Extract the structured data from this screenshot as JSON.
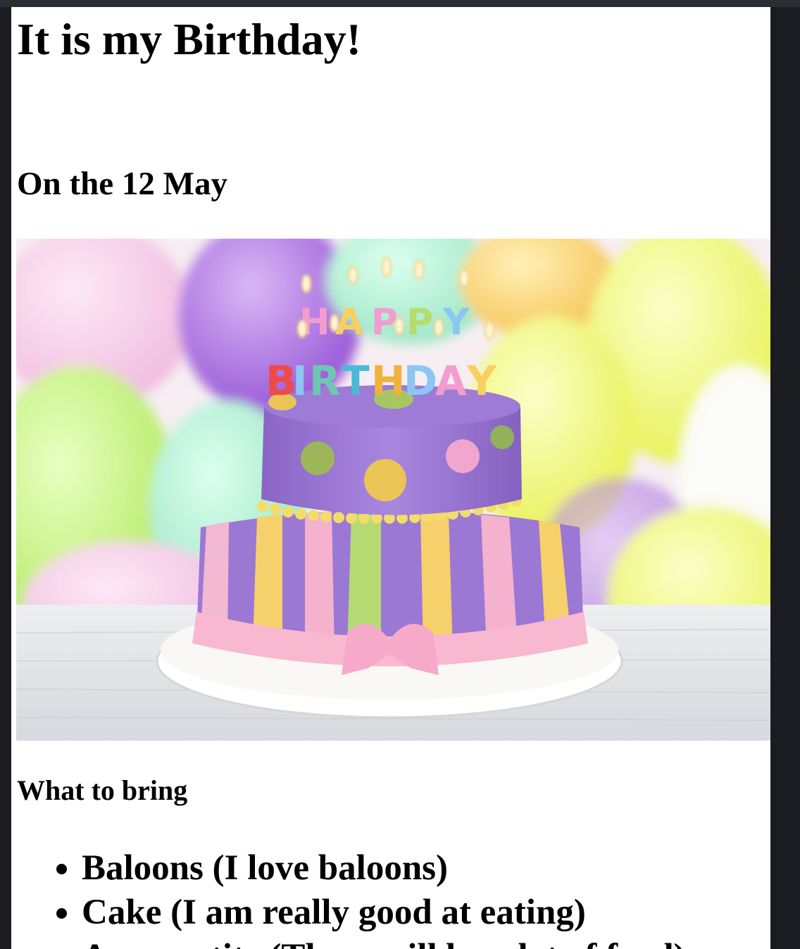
{
  "heading": "It is my Birthday!",
  "date": "On the 12 May",
  "image": {
    "alt": "Two-tier birthday cake with colorful Happy Birthday candles in front of pastel balloons",
    "candles_top": "HAPPY",
    "candles_bottom": "BIRTHDAY"
  },
  "bring_heading": "What to bring",
  "items": [
    "Baloons (I love baloons)",
    "Cake (I am really good at eating)",
    "An appetite (There will be a lot of food)"
  ],
  "colors": {
    "page_background": "#ffffff",
    "frame_background": "#1a1c21",
    "text": "#000000"
  }
}
